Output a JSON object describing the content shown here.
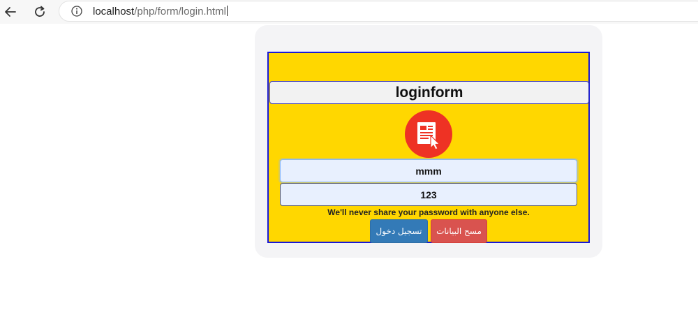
{
  "browser": {
    "url_host": "localhost",
    "url_path": "/php/form/login.html",
    "icons": {
      "back": "arrow-left-icon",
      "reload": "reload-icon",
      "info": "info-icon"
    }
  },
  "form": {
    "title": "loginform",
    "logo_icon": "form-document-cursor-icon",
    "username_value": "mmm",
    "password_value": "123",
    "help_text": "We'll never share your password with anyone else.",
    "login_button": "تسجيل دخول",
    "clear_button": "مسح البيانات"
  },
  "colors": {
    "form_background": "#ffd700",
    "form_border": "#1818d6",
    "logo": "#ee3224",
    "login_button": "#337ab7",
    "clear_button": "#d9534f"
  }
}
